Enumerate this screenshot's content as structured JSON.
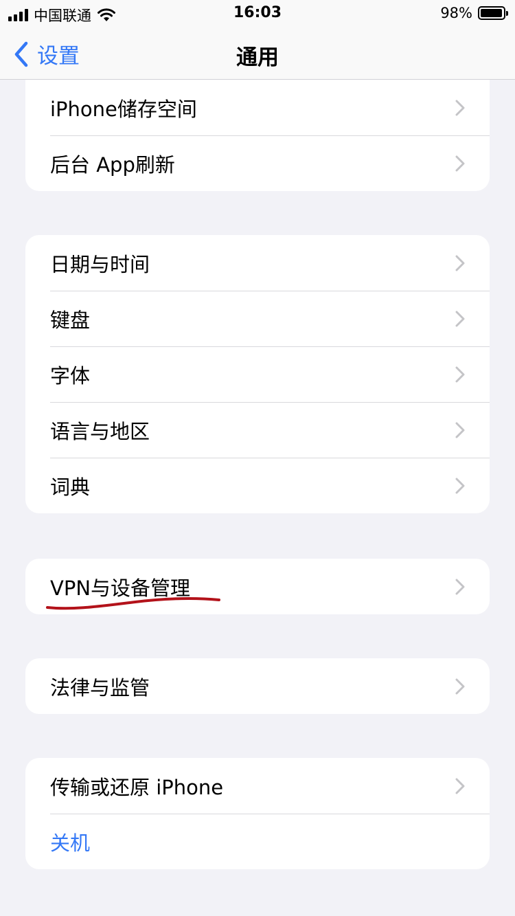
{
  "status_bar": {
    "carrier": "中国联通",
    "time": "16:03",
    "battery": "98%",
    "battery_level": 0.98
  },
  "nav": {
    "back_label": "设置",
    "title": "通用"
  },
  "groups": [
    {
      "rows": [
        {
          "label": "iPhone储存空间",
          "icon": "chevron-right-icon"
        },
        {
          "label": "后台 App刷新",
          "icon": "chevron-right-icon"
        }
      ]
    },
    {
      "rows": [
        {
          "label": "日期与时间",
          "icon": "chevron-right-icon"
        },
        {
          "label": "键盘",
          "icon": "chevron-right-icon"
        },
        {
          "label": "字体",
          "icon": "chevron-right-icon"
        },
        {
          "label": "语言与地区",
          "icon": "chevron-right-icon"
        },
        {
          "label": "词典",
          "icon": "chevron-right-icon"
        }
      ]
    },
    {
      "rows": [
        {
          "label": "VPN与设备管理",
          "icon": "chevron-right-icon"
        }
      ]
    },
    {
      "rows": [
        {
          "label": "法律与监管",
          "icon": "chevron-right-icon"
        }
      ]
    },
    {
      "rows": [
        {
          "label": "传输或还原 iPhone",
          "icon": "chevron-right-icon"
        },
        {
          "label": "关机"
        }
      ]
    }
  ],
  "colors": {
    "accent": "#3478f6",
    "background": "#f2f2f7",
    "annotation": "#b3121a"
  }
}
